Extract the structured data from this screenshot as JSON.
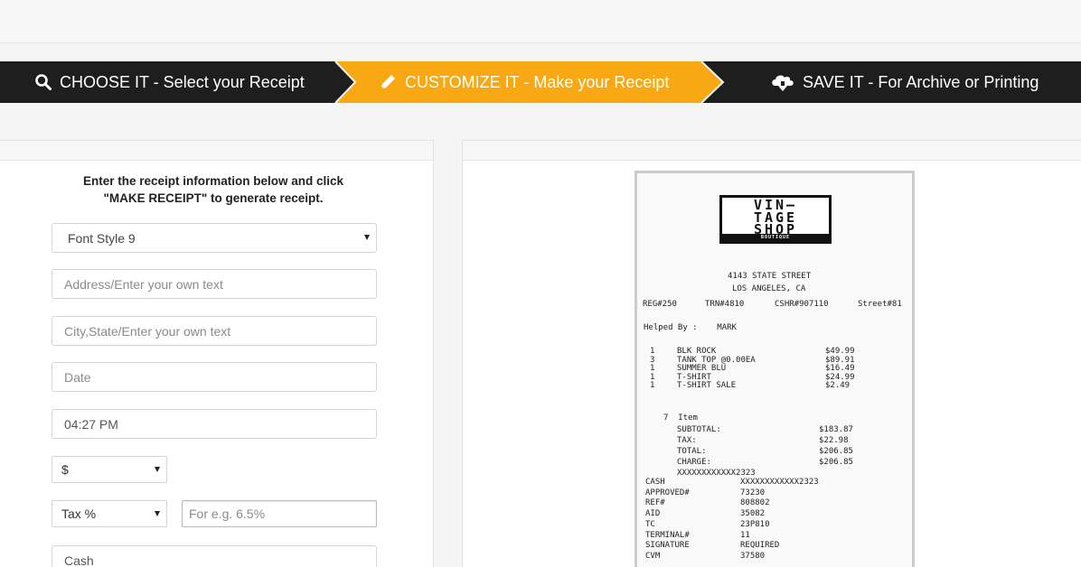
{
  "steps": [
    {
      "label": "CHOOSE IT - Select your Receipt",
      "icon": "search-icon"
    },
    {
      "label": "CUSTOMIZE IT - Make your Receipt",
      "icon": "pencil-icon"
    },
    {
      "label": "SAVE IT - For Archive or Printing",
      "icon": "cloud-download-icon"
    }
  ],
  "colors": {
    "active_step": "#f7a813",
    "bar": "#1e1e1e"
  },
  "form": {
    "instructions_line1": "Enter the receipt information below and click",
    "instructions_line2": "\"MAKE RECEIPT\" to generate receipt.",
    "font_style": "Font Style 9",
    "address_placeholder": "Address/Enter your own text",
    "city_placeholder": "City,State/Enter your own text",
    "date_placeholder": "Date",
    "time_value": "04:27 PM",
    "currency": "$",
    "tax_type": "Tax %",
    "tax_placeholder": "For e.g. 6.5%",
    "payment_value": "Cash"
  },
  "receipt": {
    "logo_line1": "VIN—",
    "logo_line2": "TAGE",
    "logo_line3": "SHOP",
    "logo_sub": "BOUTIQUE",
    "address": "4143 STATE STREET",
    "city": "LOS ANGELES, CA",
    "reg": "REG#250",
    "trn": "TRN#4810",
    "cshr": "CSHR#907110",
    "street": "Street#81",
    "helped": "Helped By :    MARK",
    "items": [
      {
        "qty": "1",
        "name": "BLK ROCK",
        "price": "$49.99"
      },
      {
        "qty": "3",
        "name": "TANK TOP @0.00EA",
        "price": "$89.91"
      },
      {
        "qty": "1",
        "name": "SUMMER BLU",
        "price": "$16.49"
      },
      {
        "qty": "1",
        "name": "T-SHIRT",
        "price": "$24.99"
      },
      {
        "qty": "1",
        "name": "T-SHIRT SALE",
        "price": "$2.49"
      }
    ],
    "item_count": "7  Item",
    "totals": [
      {
        "label": "SUBTOTAL:",
        "value": "$183.87"
      },
      {
        "label": "TAX:",
        "value": "$22.98"
      },
      {
        "label": "TOTAL:",
        "value": "$206.85"
      },
      {
        "label": "CHARGE:",
        "value": "$206.85"
      }
    ],
    "card_masked": "XXXXXXXXXXXX2323",
    "details": [
      {
        "label": "CASH",
        "value": "XXXXXXXXXXXX2323"
      },
      {
        "label": "APPROVED#",
        "value": "73230"
      },
      {
        "label": "REF#",
        "value": "808802"
      },
      {
        "label": "AID",
        "value": "35082"
      },
      {
        "label": "TC",
        "value": "23P810"
      },
      {
        "label": "TERMINAL#",
        "value": "11"
      },
      {
        "label": "SIGNATURE",
        "value": "REQUIRED"
      },
      {
        "label": "CVM",
        "value": "37580"
      }
    ]
  }
}
